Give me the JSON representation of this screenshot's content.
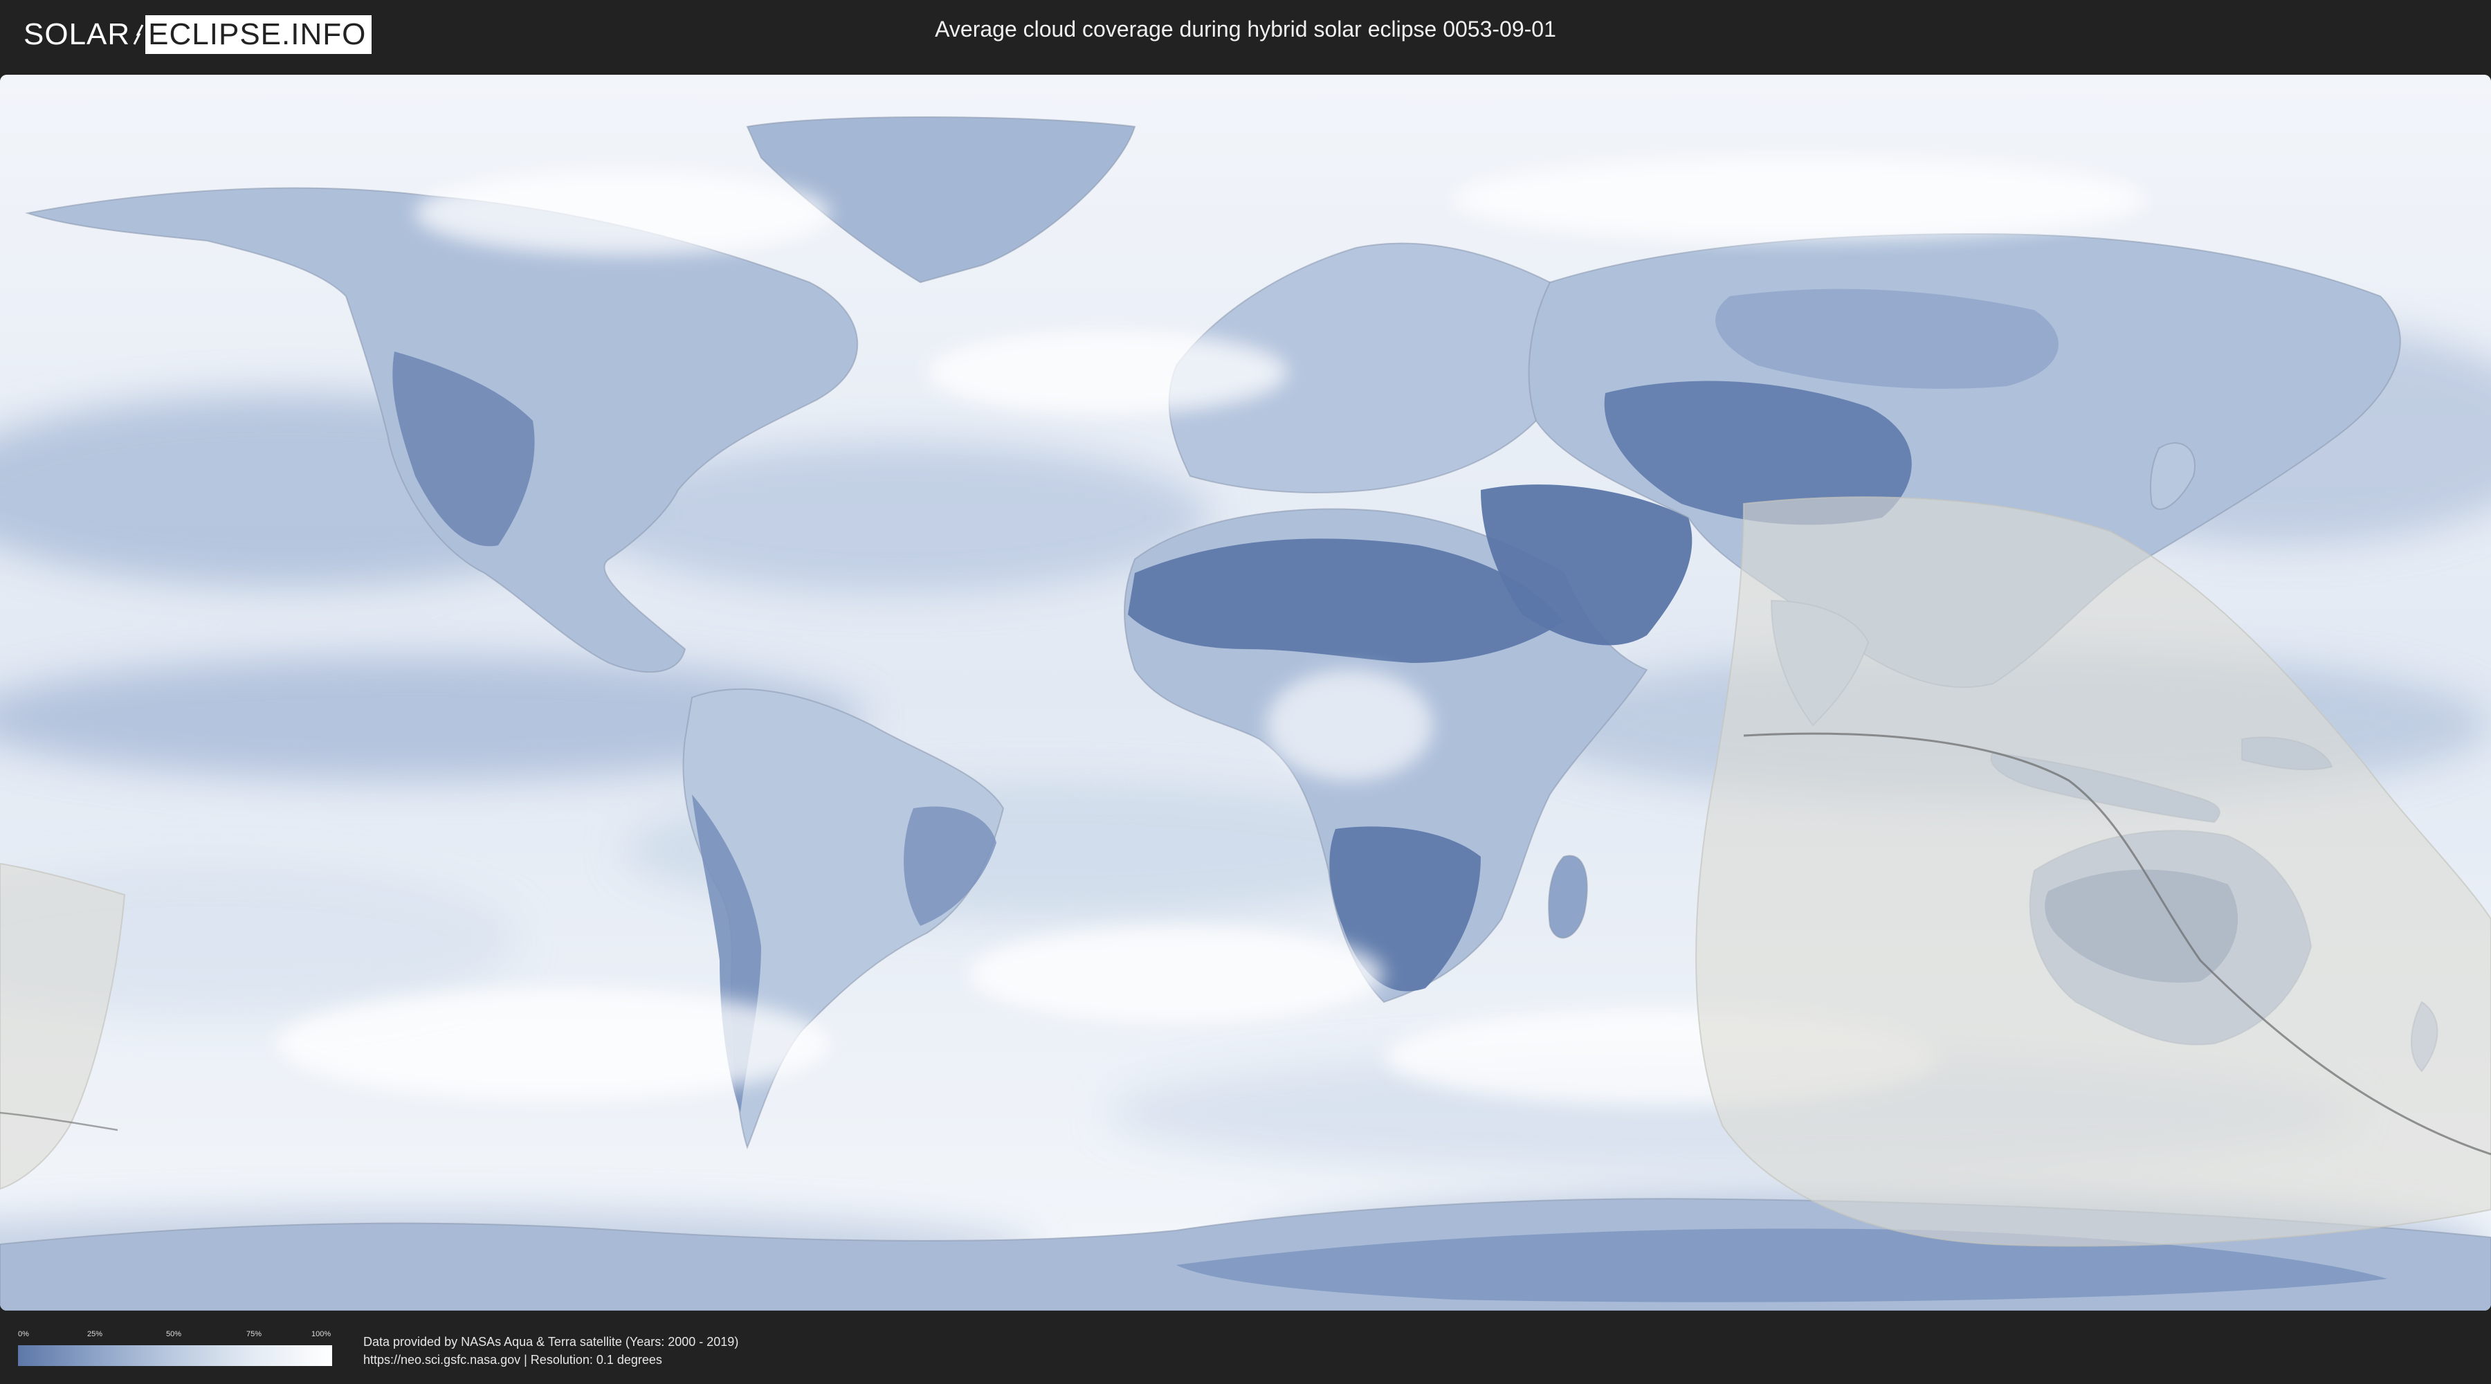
{
  "header": {
    "logo_left": "SOLAR",
    "logo_right": "ECLIPSE.INFO",
    "title": "Average cloud coverage during hybrid solar eclipse 0053-09-01"
  },
  "legend": {
    "ticks": [
      "0%",
      "25%",
      "50%",
      "75%",
      "100%"
    ],
    "color_low": "#5d78a8",
    "color_high": "#ffffff"
  },
  "footer": {
    "source_line": "Data provided by NASAs Aqua & Terra satellite (Years: 2000 - 2019)",
    "url_line": "https://neo.sci.gsfc.nasa.gov | Resolution: 0.1 degrees"
  },
  "map": {
    "projection": "equirectangular",
    "eclipse_shadow_color": "#d8d8d4",
    "cloud_low_color": "#5b76a6",
    "cloud_high_color": "#ffffff"
  }
}
